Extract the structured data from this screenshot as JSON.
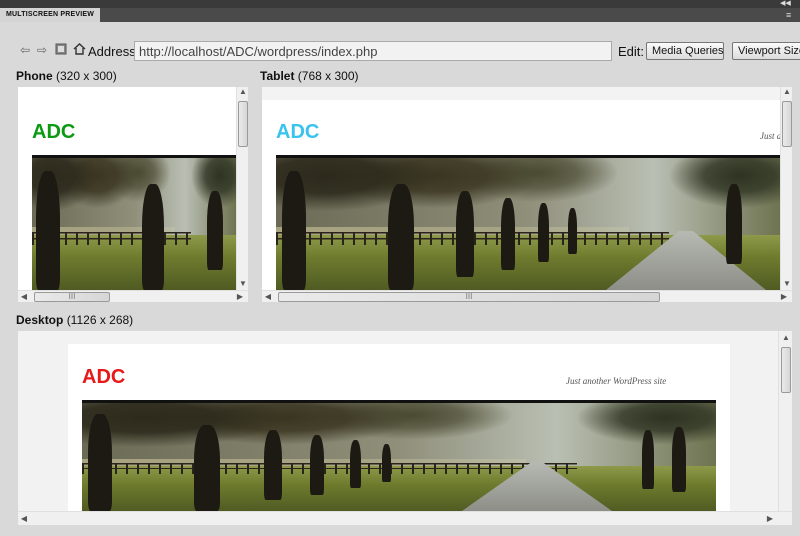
{
  "panel": {
    "tab_title": "MULTISCREEN PREVIEW"
  },
  "toolbar": {
    "address_label": "Address:",
    "address_value": "http://localhost/ADC/wordpress/index.php",
    "edit_label": "Edit:",
    "media_queries_label": "Media Queries...",
    "viewport_sizes_label": "Viewport Sizes..."
  },
  "icons": [
    "back-arrow-icon",
    "forward-arrow-icon",
    "refresh-icon",
    "home-icon"
  ],
  "viewports": {
    "phone": {
      "name": "Phone",
      "size": "(320 x 300)",
      "site_title": "ADC",
      "title_color": "#0b9a12"
    },
    "tablet": {
      "name": "Tablet",
      "size": "(768 x 300)",
      "site_title": "ADC",
      "title_color": "#38c4ee",
      "tagline": "Just a"
    },
    "desktop": {
      "name": "Desktop",
      "size": "(1126 x 268)",
      "site_title": "ADC",
      "title_color": "#e8191b",
      "tagline": "Just another WordPress site"
    }
  },
  "colors": {
    "chrome_dark": "#4a4a4a",
    "panel_bg": "#d9d9d9",
    "page_bg": "#ffffff"
  }
}
